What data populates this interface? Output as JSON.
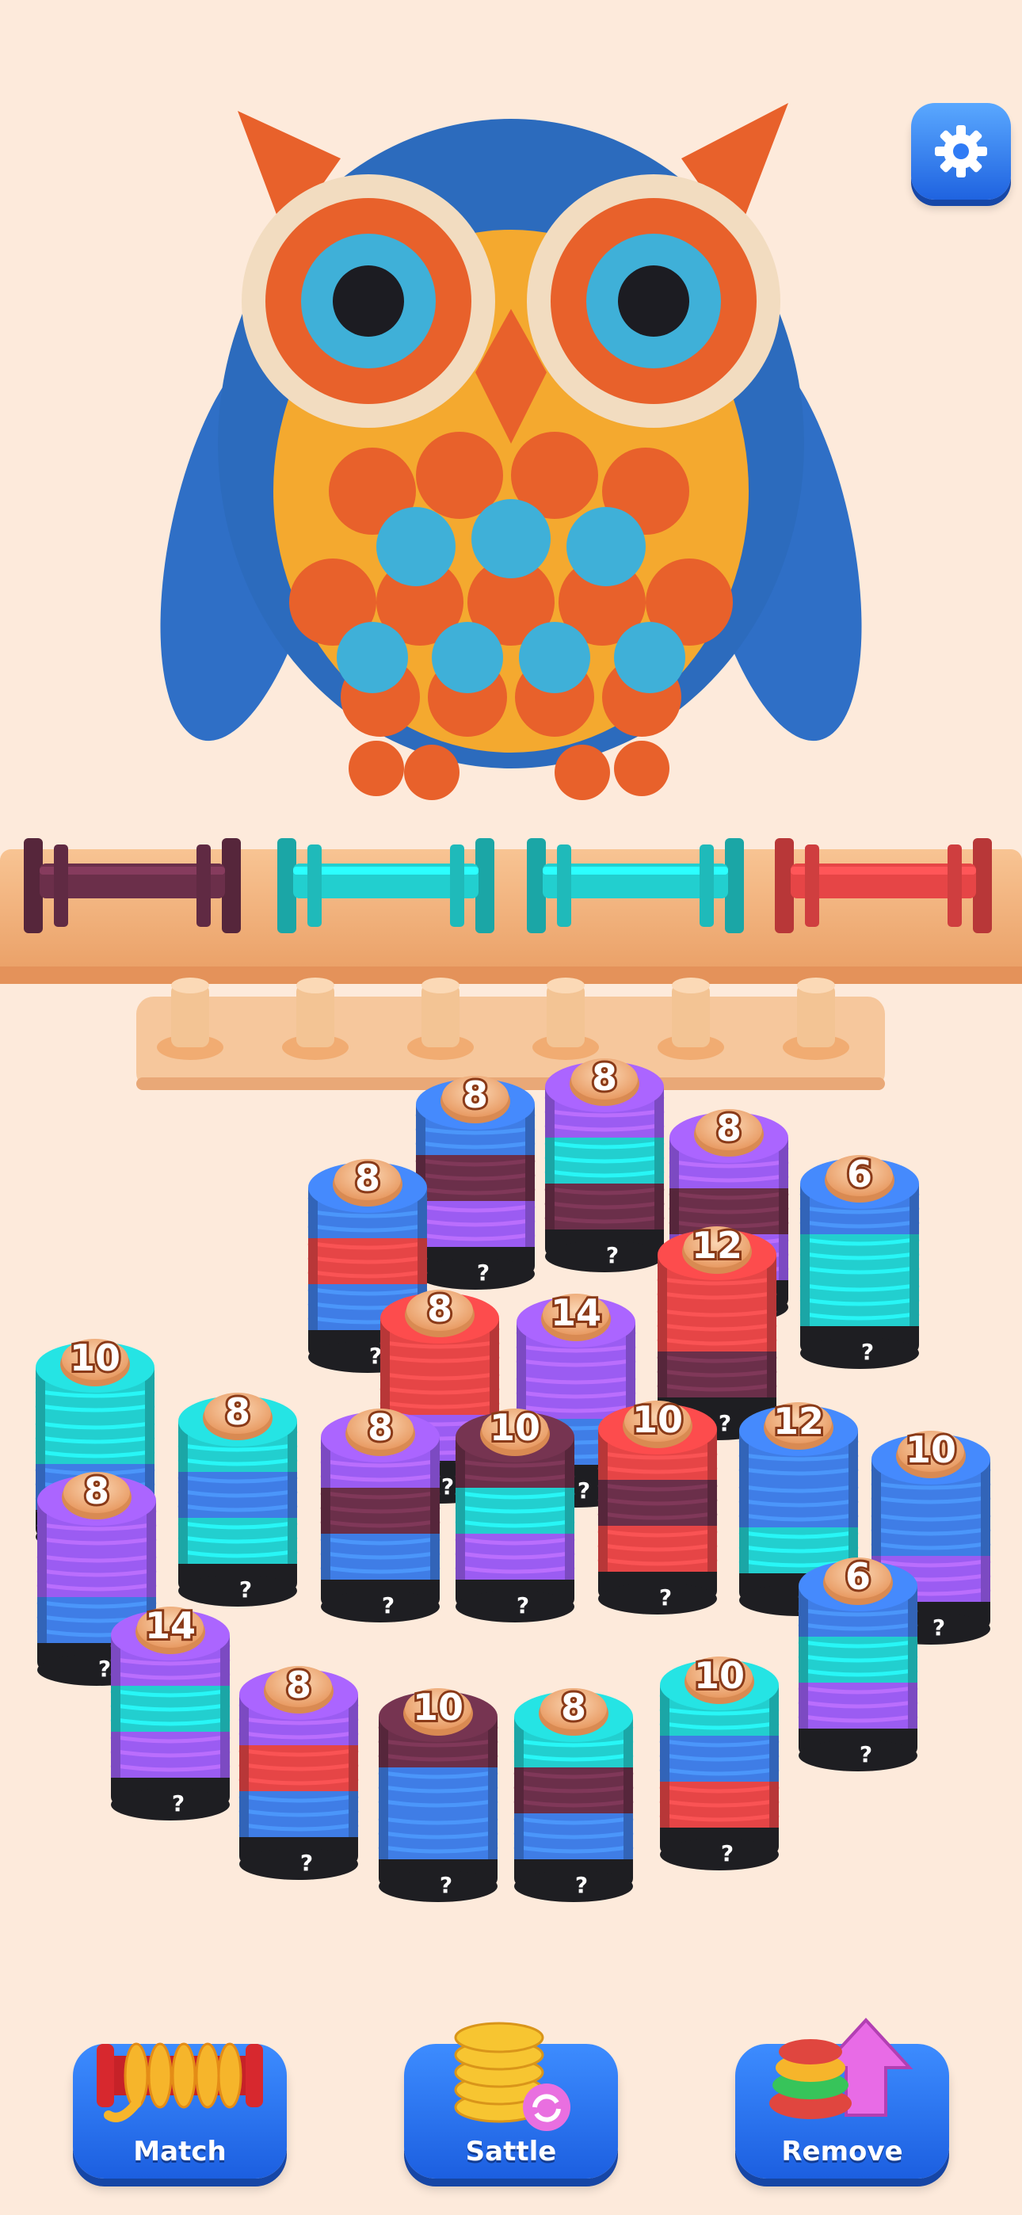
{
  "colors": {
    "background": "#fdeadb",
    "shelf": "#f5b57f",
    "peg": "#f3c494",
    "accent_button": "#2f7bf5",
    "yarn": {
      "blue": "#3f7de6",
      "purple": "#9b5cf2",
      "cyan": "#22cfcf",
      "red": "#e64546",
      "maroon": "#6b2f4a",
      "black": "#1e1e22"
    }
  },
  "header": {
    "image": "knitted-owl",
    "settings_icon": "gear-icon"
  },
  "spools": [
    {
      "color": "maroon"
    },
    {
      "color": "cyan"
    },
    {
      "color": "cyan"
    },
    {
      "color": "red"
    }
  ],
  "empty_pegs": 6,
  "stacks": [
    {
      "count": "8",
      "bands": [
        "blue",
        "maroon",
        "purple"
      ]
    },
    {
      "count": "8",
      "bands": [
        "purple",
        "cyan",
        "maroon"
      ]
    },
    {
      "count": "8",
      "bands": [
        "purple",
        "maroon",
        "purple"
      ]
    },
    {
      "count": "8",
      "bands": [
        "blue",
        "red",
        "blue"
      ]
    },
    {
      "count": "6",
      "bands": [
        "blue",
        "cyan",
        "cyan"
      ]
    },
    {
      "count": "12",
      "bands": [
        "red",
        "red",
        "maroon"
      ]
    },
    {
      "count": "8",
      "bands": [
        "red",
        "red",
        "purple"
      ]
    },
    {
      "count": "14",
      "bands": [
        "purple",
        "purple",
        "blue"
      ]
    },
    {
      "count": "10",
      "bands": [
        "cyan",
        "cyan",
        "blue"
      ]
    },
    {
      "count": "8",
      "bands": [
        "cyan",
        "blue",
        "cyan"
      ]
    },
    {
      "count": "8",
      "bands": [
        "purple",
        "maroon",
        "blue"
      ]
    },
    {
      "count": "10",
      "bands": [
        "maroon",
        "cyan",
        "purple"
      ]
    },
    {
      "count": "10",
      "bands": [
        "red",
        "maroon",
        "red"
      ]
    },
    {
      "count": "12",
      "bands": [
        "blue",
        "blue",
        "cyan"
      ]
    },
    {
      "count": "10",
      "bands": [
        "blue",
        "blue",
        "purple"
      ]
    },
    {
      "count": "8",
      "bands": [
        "purple",
        "purple",
        "blue"
      ]
    },
    {
      "count": "6",
      "bands": [
        "blue",
        "cyan",
        "purple"
      ]
    },
    {
      "count": "14",
      "bands": [
        "purple",
        "cyan",
        "purple"
      ]
    },
    {
      "count": "8",
      "bands": [
        "purple",
        "red",
        "blue"
      ]
    },
    {
      "count": "10",
      "bands": [
        "maroon",
        "blue",
        "blue"
      ]
    },
    {
      "count": "8",
      "bands": [
        "cyan",
        "maroon",
        "blue"
      ]
    },
    {
      "count": "10",
      "bands": [
        "cyan",
        "blue",
        "red"
      ]
    }
  ],
  "hidden_marker": "?",
  "buttons": {
    "match": {
      "label": "Match",
      "icon": "rope-spool-icon"
    },
    "sattle": {
      "label": "Sattle",
      "icon": "coin-shuffle-icon"
    },
    "remove": {
      "label": "Remove",
      "icon": "yarn-arrow-icon"
    }
  }
}
